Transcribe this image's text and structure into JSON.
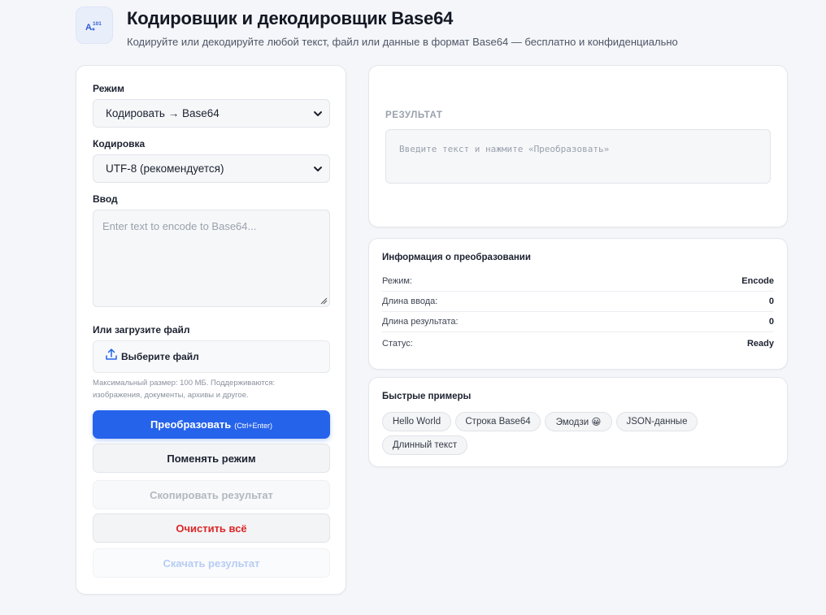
{
  "header": {
    "logo_icon": "text-convert-icon",
    "title": "Кодировщик и декодировщик Base64",
    "subtitle": "Кодируйте или декодируйте любой текст, файл или данные в формат Base64 — бесплатно и конфиденциально"
  },
  "form": {
    "mode_label": "Режим",
    "mode_value": "Кодировать → Base64",
    "encoding_label": "Кодировка",
    "encoding_value": "UTF-8 (рекомендуется)",
    "input_label": "Ввод",
    "input_placeholder": "Enter text to encode to Base64...",
    "file_label": "Или загрузите файл",
    "file_button": "Выберите файл",
    "file_hint": "Максимальный размер: 100 МБ. Поддерживаются: изображения, документы, архивы и другое."
  },
  "buttons": {
    "convert": "Преобразовать",
    "convert_shortcut": "(Ctrl+Enter)",
    "swap": "Поменять режим",
    "copy": "Скопировать результат",
    "clear": "Очистить всё",
    "download": "Скачать результат"
  },
  "result": {
    "label": "РЕЗУЛЬТАТ",
    "placeholder": "Введите текст и нажмите «Преобразовать»"
  },
  "info": {
    "title": "Информация о преобразовании",
    "rows": [
      {
        "label": "Режим:",
        "value": "Encode"
      },
      {
        "label": "Длина ввода:",
        "value": "0"
      },
      {
        "label": "Длина результата:",
        "value": "0"
      },
      {
        "label": "Статус:",
        "value": "Ready"
      }
    ]
  },
  "examples": {
    "title": "Быстрые примеры",
    "chips": [
      "Hello World",
      "Строка Base64",
      "Эмодзи 😀",
      "JSON-данные",
      "Длинный текст"
    ]
  },
  "colors": {
    "primary": "#2563eb",
    "danger": "#dc2626",
    "background": "#f5f6f9"
  }
}
